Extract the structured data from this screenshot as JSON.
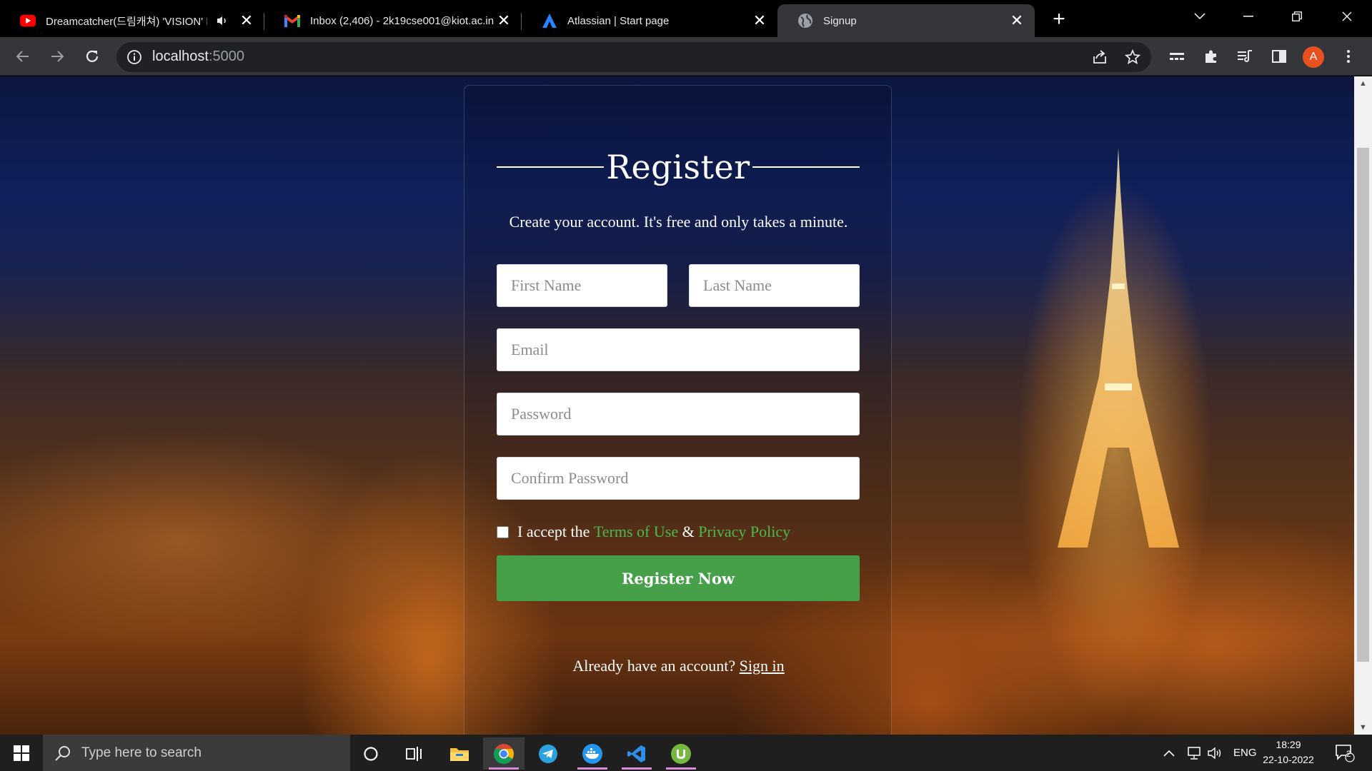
{
  "browser": {
    "tabs": [
      {
        "title": "Dreamcatcher(드림캐쳐) 'VISION' I",
        "icon": "youtube-icon",
        "muted_indicator": "speaker-icon"
      },
      {
        "title": "Inbox (2,406) - 2k19cse001@kiot.ac.in -",
        "icon": "gmail-icon"
      },
      {
        "title": "Atlassian | Start page",
        "icon": "atlassian-icon"
      },
      {
        "title": "Signup",
        "icon": "globe-icon",
        "active": true
      }
    ],
    "address_host": "localhost",
    "address_port": ":5000",
    "profile_initial": "A"
  },
  "form": {
    "heading": "Register",
    "subtitle": "Create your account. It's free and only takes a minute.",
    "first_name_placeholder": "First Name",
    "last_name_placeholder": "Last Name",
    "email_placeholder": "Email",
    "password_placeholder": "Password",
    "confirm_password_placeholder": "Confirm Password",
    "terms_prefix": "I accept the",
    "terms_link": "Terms of Use",
    "terms_amp": "&",
    "privacy_link": "Privacy Policy",
    "submit_label": "Register Now",
    "signin_prefix": "Already have an account?",
    "signin_link": "Sign in",
    "accent_color": "#46a049"
  },
  "taskbar": {
    "search_placeholder": "Type here to search",
    "language": "ENG",
    "time": "18:29",
    "date": "22-10-2022",
    "notification_count": "2"
  }
}
